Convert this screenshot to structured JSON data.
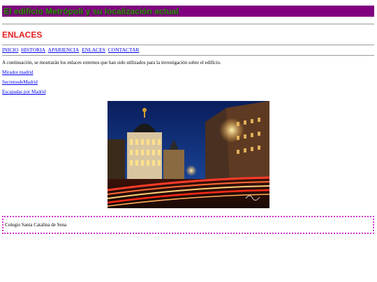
{
  "banner": {
    "title": "El edificio Metrópoli y su localización actual"
  },
  "page": {
    "heading": "ENLACES"
  },
  "nav": {
    "items": [
      "INICIO",
      "HISTORIA",
      "APARIENCIA",
      "ENLACES",
      "CONTACTAR"
    ]
  },
  "intro": "A continuación, se mostrarán los enlaces externos que han sido utilizados para la investigación sobre el edificio.",
  "links": [
    "Mirador madrid",
    "SecretosdeMadrid",
    "Escapadas por Madrid"
  ],
  "photo": {
    "subject": "Metrópolis building at night, Gran Vía, Madrid"
  },
  "footer": {
    "text": "Colegio Santa Catalina de Sena"
  },
  "colors": {
    "banner_bg": "#800080",
    "heading": "#e01e1e",
    "link": "#0000ee",
    "footer_border": "#cc33cc"
  }
}
